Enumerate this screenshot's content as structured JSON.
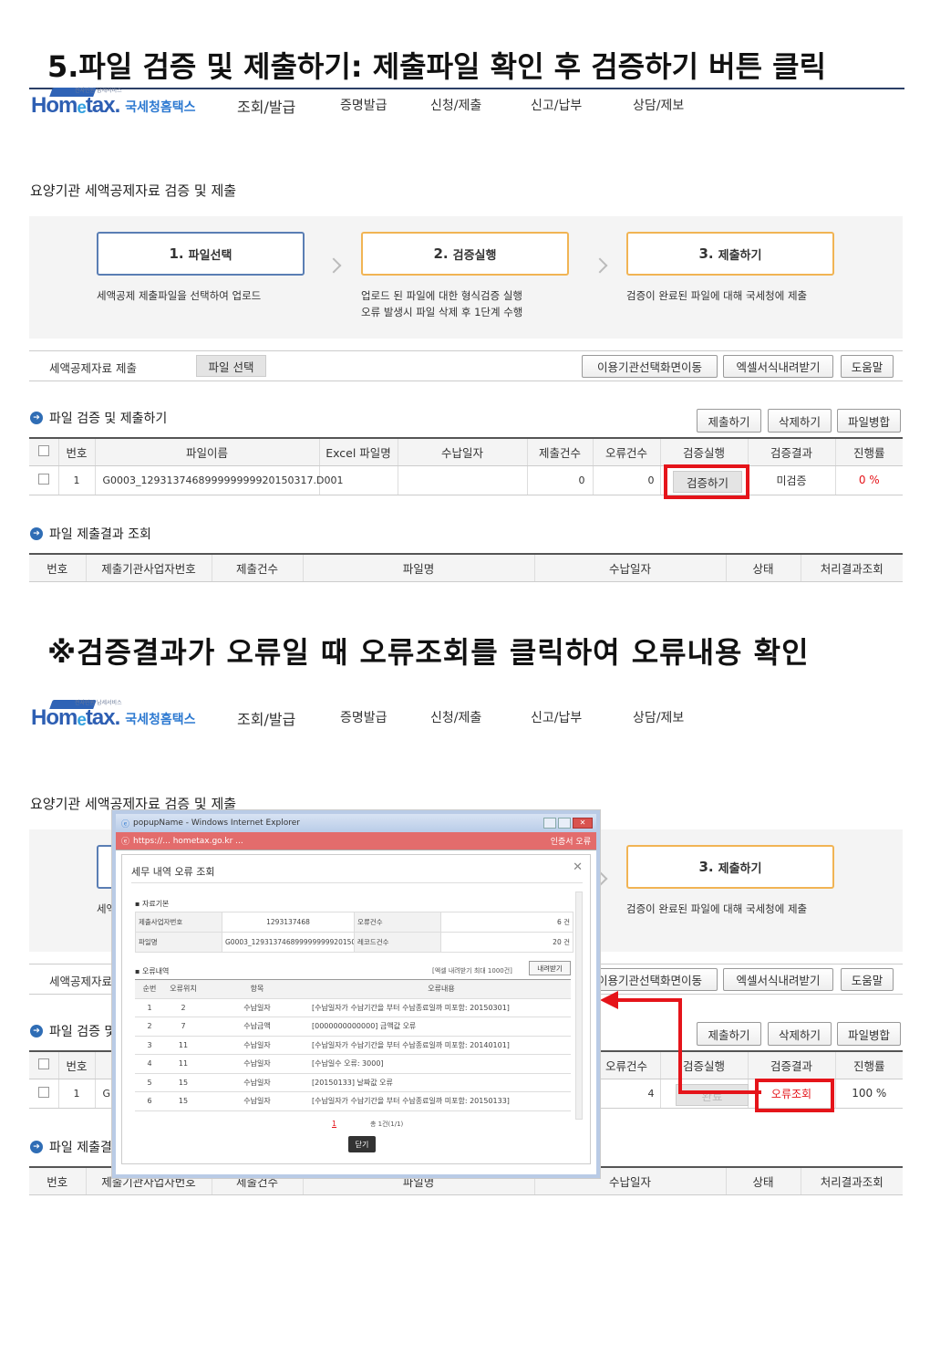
{
  "section1": {
    "heading": "5.파일 검증 및 제출하기: 제출파일 확인 후 검증하기 버튼 클릭"
  },
  "section2": {
    "heading": "※검증결과가 오류일 때 오류조회를 클릭하여 오류내용 확인"
  },
  "header": {
    "logo_small": "전자민원 납세서비스",
    "logo_main": "Hom",
    "logo_e": "e",
    "logo_tax": "tax.",
    "logo_kr": "국세청홈택스",
    "nav": [
      "조회/발급",
      "증명발급",
      "신청/제출",
      "신고/납부",
      "상담/제보"
    ]
  },
  "page": {
    "title": "요양기관 세액공제자료 검증 및 제출",
    "steps": [
      {
        "num": "1.",
        "label": "파일선택",
        "desc1": "세액공제 제출파일을 선택하여 업로드",
        "desc2": ""
      },
      {
        "num": "2.",
        "label": "검증실행",
        "desc1": "업로드 된 파일에 대한 형식검증 실행",
        "desc2": "오류 발생시 파일 삭제 후 1단계 수행"
      },
      {
        "num": "3.",
        "label": "제출하기",
        "desc1": "검증이 완료된 파일에 대해 국세청에 제출",
        "desc2": ""
      }
    ],
    "toolbar": {
      "label": "세액공제자료 제출",
      "select_file": "파일 선택",
      "btn_institution": "이용기관선택화면이동",
      "btn_excel": "엑셀서식내려받기",
      "btn_help": "도움말"
    },
    "verify_section": {
      "title": "파일 검증 및 제출하기",
      "btn_submit": "제출하기",
      "btn_delete": "삭제하기",
      "btn_merge": "파일병합",
      "columns": [
        "번호",
        "파일이름",
        "Excel 파일명",
        "수납일자",
        "제출건수",
        "오류건수",
        "검증실행",
        "검증결과",
        "진행률"
      ]
    },
    "result_section": {
      "title": "파일 제출결과 조회",
      "columns": [
        "번호",
        "제출기관사업자번호",
        "제출건수",
        "파일명",
        "수납일자",
        "상태",
        "처리결과조회"
      ]
    }
  },
  "row1": {
    "no": "1",
    "filename": "G0003_129313746899999999920150317.D001",
    "excel": "",
    "date": "",
    "submit_count": "0",
    "error_count": "0",
    "action": "검증하기",
    "result": "미검증",
    "progress": "0 %"
  },
  "row2": {
    "no": "1",
    "filename_visible": "G",
    "error_count": "4",
    "action": "완료",
    "result": "오류조회",
    "progress": "100 %"
  },
  "popup": {
    "window_title": "popupName - Windows Internet Explorer",
    "address": "https://... hometax.go.kr ...",
    "cert_error": "인증서 오류",
    "title": "세무 내역 오류 조회",
    "basic_label": "자료기본",
    "kv": [
      {
        "k": "제출사업자번호",
        "v": "1293137468",
        "k2": "오류건수",
        "v2": "6 건"
      },
      {
        "k": "파일명",
        "v": "G0003_129313746899999999920150317.D001",
        "k2": "레코드건수",
        "v2": "20 건"
      }
    ],
    "error_label": "오류내역",
    "excel_note": "[엑셀 내려받기 최대 1000건]",
    "excel_btn": "내려받기",
    "columns": [
      "순번",
      "오류위치",
      "항목",
      "오류내용"
    ],
    "rows": [
      [
        "1",
        "2",
        "수납일자",
        "[수납일자가 수납기간을 부터 수납종료일까 미포함: 20150301]"
      ],
      [
        "2",
        "7",
        "수납금액",
        "[0000000000000] 금액값 오류"
      ],
      [
        "3",
        "11",
        "수납일자",
        "[수납일자가 수납기간을 부터 수납종료일까 미포함: 20140101]"
      ],
      [
        "4",
        "11",
        "수납일자",
        "[수납일수 오류: 3000]"
      ],
      [
        "5",
        "15",
        "수납일자",
        "[20150133] 날짜값 오류"
      ],
      [
        "6",
        "15",
        "수납일자",
        "[수납일자가 수납기간을 부터 수납종료일까 미포함: 20150133]"
      ]
    ],
    "page": "1",
    "total": "총 1건(1/1)",
    "close_btn": "닫기"
  }
}
